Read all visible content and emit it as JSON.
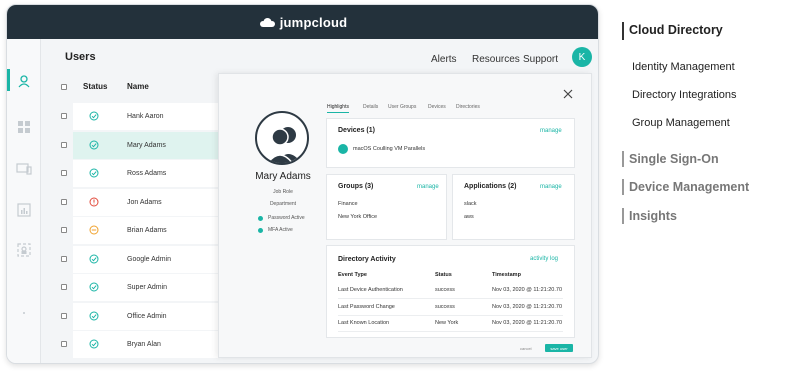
{
  "brand": {
    "name": "jumpcloud"
  },
  "header": {
    "title": "Users",
    "nav": [
      "Alerts",
      "Resources",
      "Support"
    ],
    "avatar_initial": "K"
  },
  "table": {
    "columns": [
      "Status",
      "Name"
    ],
    "rows": [
      {
        "name": "Hank Aaron",
        "status": "ok"
      },
      {
        "name": "Mary Adams",
        "status": "ok",
        "selected": true
      },
      {
        "name": "Ross Adams",
        "status": "ok"
      },
      {
        "name": "Jon Adams",
        "status": "error"
      },
      {
        "name": "Brian Adams",
        "status": "warning"
      },
      {
        "name": "Google Admin",
        "status": "ok"
      },
      {
        "name": "Super Admin",
        "status": "ok"
      },
      {
        "name": "Office Admin",
        "status": "ok"
      },
      {
        "name": "Bryan Alan",
        "status": "ok"
      }
    ]
  },
  "panel": {
    "tabs": [
      "Highlights",
      "Details",
      "User Groups",
      "Devices",
      "Directories"
    ],
    "profile": {
      "name": "Mary Adams",
      "job_role": "Job Role",
      "department": "Department",
      "flags": [
        "Password Active",
        "MFA Active"
      ]
    },
    "devices": {
      "title": "Devices (1)",
      "link": "manage",
      "item": "macOS Coulling VM Parallels"
    },
    "groups": {
      "title": "Groups (3)",
      "link": "manage",
      "items": [
        "Finance",
        "New York Office"
      ]
    },
    "applications": {
      "title": "Applications (2)",
      "link": "manage",
      "items": [
        "slack",
        "aws"
      ]
    },
    "activity": {
      "title": "Directory Activity",
      "link": "activity log",
      "headers": [
        "Event Type",
        "Status",
        "Timestamp"
      ],
      "rows": [
        {
          "event": "Last Device Authentication",
          "status": "success",
          "time": "Nov 03, 2020 @ 11:21:20.70"
        },
        {
          "event": "Last Password Change",
          "status": "success",
          "time": "Nov 03, 2020 @ 11:21:20.70"
        },
        {
          "event": "Last Known Location",
          "status": "New York",
          "time": "Nov 03, 2020 @ 11:21:20.70"
        }
      ]
    },
    "buttons": {
      "cancel": "cancel",
      "save": "save user"
    }
  },
  "sidebar_list": {
    "active": "Cloud Directory",
    "active_items": [
      "Identity Management",
      "Directory Integrations",
      "Group Management"
    ],
    "others": [
      "Single Sign-On",
      "Device Management",
      "Insights"
    ]
  },
  "colors": {
    "accent": "#1ab5a6",
    "topbar": "#23313b",
    "ok": "#1ab5a6",
    "error": "#e24a3b",
    "warning": "#f0a22e"
  }
}
